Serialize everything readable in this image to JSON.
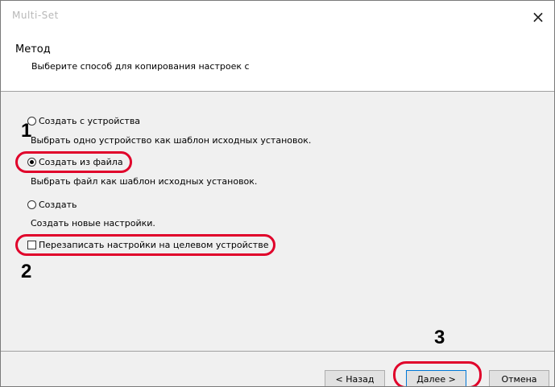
{
  "window": {
    "title": "Multi-Set",
    "close_symbol": "×"
  },
  "header": {
    "title": "Метод",
    "subtitle": "Выберите способ для копирования настроек с"
  },
  "options": [
    {
      "label": "Создать с устройства",
      "description": "Выбрать одно устройство как шаблон исходных установок.",
      "checked": false
    },
    {
      "label": "Создать из файла",
      "description": "Выбрать файл как шаблон исходных установок.",
      "checked": true
    },
    {
      "label": "Создать",
      "description": "Создать новые настройки.",
      "checked": false
    }
  ],
  "overwrite_checkbox": {
    "label": "Перезаписать настройки на целевом устройстве",
    "checked": false
  },
  "steps": [
    "1",
    "2",
    "3"
  ],
  "highlight_color": "#e0002a",
  "buttons": {
    "back": "< Назад",
    "next": "Далее >",
    "cancel": "Отмена"
  }
}
